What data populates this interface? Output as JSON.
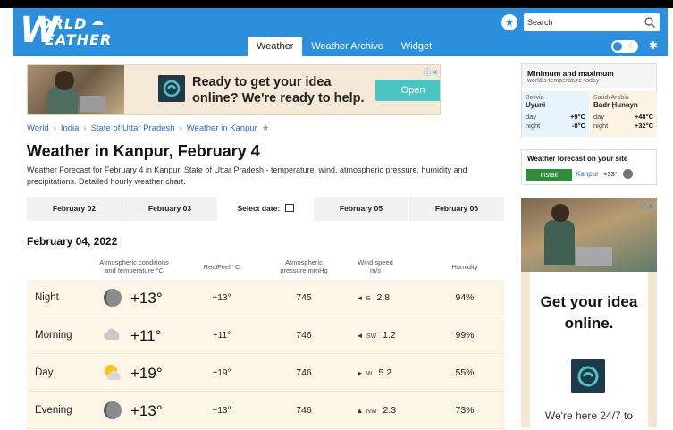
{
  "brand": {
    "line1": "ORLD",
    "line2": "EATHER",
    "initial": "W"
  },
  "search": {
    "placeholder": "Search"
  },
  "nav": {
    "tabs": [
      "Weather",
      "Weather Archive",
      "Widget"
    ]
  },
  "ad_banner": {
    "headline": "Ready to get your idea online? We're ready to help.",
    "cta": "Open"
  },
  "breadcrumb": [
    "World",
    "India",
    "State of Uttar Pradesh",
    "Weather in Kanpur"
  ],
  "page": {
    "title": "Weather in Kanpur, February 4",
    "description": "Weather Forecast for February 4 in Kanpur, State of Uttar Pradesh - temperature, wind, atmospheric pressure, humidity and precipitations. Detailed hourly weather chart."
  },
  "date_tabs": {
    "prev2": "February 02",
    "prev1": "February 03",
    "select": "Select date:",
    "next1": "February 05",
    "next2": "February 06"
  },
  "section_date": "February 04, 2022",
  "table": {
    "headers": {
      "conditions_l1": "Atmospheric conditions",
      "conditions_l2": "and temperature °C",
      "realfeel": "RealFeel °C",
      "pressure_l1": "Atmospheric",
      "pressure_l2": "pressure mmHg",
      "wind_l1": "Wind speed",
      "wind_l2": "m/s",
      "humidity": "Humidity"
    },
    "rows": [
      {
        "period": "Night",
        "icon": "moon-icon",
        "temp": "+13°",
        "realfeel": "+13°",
        "pressure": "745",
        "wind_arrow": "◄",
        "wind_dir": "E",
        "wind_speed": "2.8",
        "humidity": "94%"
      },
      {
        "period": "Morning",
        "icon": "cloud-icon",
        "temp": "+11°",
        "realfeel": "+11°",
        "pressure": "746",
        "wind_arrow": "◄",
        "wind_dir": "SW",
        "wind_speed": "1.2",
        "humidity": "99%"
      },
      {
        "period": "Day",
        "icon": "partly-sunny-icon",
        "temp": "+19°",
        "realfeel": "+19°",
        "pressure": "746",
        "wind_arrow": "►",
        "wind_dir": "W",
        "wind_speed": "5.2",
        "humidity": "55%"
      },
      {
        "period": "Evening",
        "icon": "moon-icon",
        "temp": "+13°",
        "realfeel": "+13°",
        "pressure": "746",
        "wind_arrow": "▲",
        "wind_dir": "NW",
        "wind_speed": "2.3",
        "humidity": "73%"
      }
    ]
  },
  "minmax": {
    "title": "Minimum and maximum",
    "subtitle": "world's temperature today",
    "left": {
      "country": "Bolivia",
      "city": "Uyuni",
      "day_label": "day",
      "day": "+9°C",
      "night_label": "night",
      "night": "-8°C"
    },
    "right": {
      "country": "Saudi Arabia",
      "city": "Badr Ḩunayn",
      "day_label": "day",
      "day": "+48°C",
      "night_label": "night",
      "night": "+32°C"
    }
  },
  "forecast_widget": {
    "title": "Weather forecast on your site",
    "install": "Install",
    "city": "Kanpur",
    "temp": "+33°"
  },
  "side_ad": {
    "headline": "Get your idea online.",
    "footer": "We're here 24/7 to"
  },
  "colors": {
    "header": "#2c8fde",
    "row_bg": "#fdf6e7",
    "install": "#2f8a3a",
    "link": "#2c6ad0"
  }
}
